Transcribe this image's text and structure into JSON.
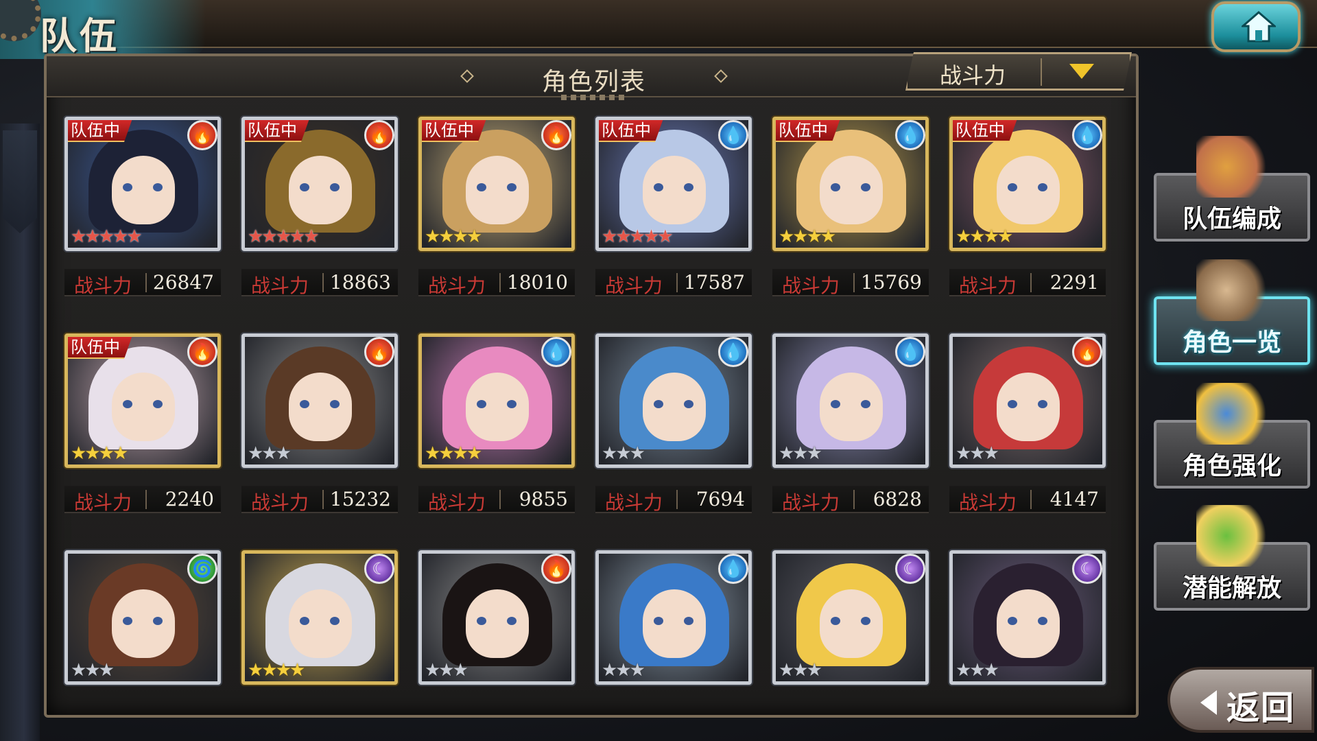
{
  "screen": {
    "title": "队伍"
  },
  "panel": {
    "title": "角色列表",
    "sort": {
      "selected": "战斗力"
    }
  },
  "colors": {
    "accent": "#6fe3f0",
    "in_team": "#d62a2a",
    "power_label": "#c93a35",
    "sort_arrow": "#f0c42a"
  },
  "power_label": "战斗力",
  "in_team_label": "队伍中",
  "characters": [
    {
      "in_team": true,
      "element": "fire",
      "stars": 5,
      "star_color": "red",
      "frame": "silver",
      "power": "26847",
      "hair": "#1d2236",
      "bg": "#3c5b9a"
    },
    {
      "in_team": true,
      "element": "fire",
      "stars": 5,
      "star_color": "red",
      "frame": "silver",
      "power": "18863",
      "hair": "#8a6a2c",
      "bg": "#3a3026"
    },
    {
      "in_team": true,
      "element": "fire",
      "stars": 4,
      "star_color": "gold",
      "frame": "gold",
      "power": "18010",
      "hair": "#caa060",
      "bg": "#c9b07a"
    },
    {
      "in_team": true,
      "element": "water",
      "stars": 5,
      "star_color": "red",
      "frame": "silver",
      "power": "17587",
      "hair": "#b8c8e6",
      "bg": "#6a7ab8"
    },
    {
      "in_team": true,
      "element": "water",
      "stars": 4,
      "star_color": "gold",
      "frame": "gold",
      "power": "15769",
      "hair": "#e9c07a",
      "bg": "#b89a4a"
    },
    {
      "in_team": true,
      "element": "water",
      "stars": 4,
      "star_color": "gold",
      "frame": "gold",
      "power": "2291",
      "hair": "#f1c86a",
      "bg": "#8a5a6a"
    },
    {
      "in_team": true,
      "element": "fire",
      "stars": 4,
      "star_color": "gold",
      "frame": "gold",
      "power": "2240",
      "hair": "#e8e0ea",
      "bg": "#c4a8b0"
    },
    {
      "in_team": false,
      "element": "fire",
      "stars": 3,
      "star_color": "silver",
      "frame": "silver",
      "power": "15232",
      "hair": "#5a3a26",
      "bg": "#8a8a8a"
    },
    {
      "in_team": false,
      "element": "water",
      "stars": 4,
      "star_color": "gold",
      "frame": "gold",
      "power": "9855",
      "hair": "#e88ac0",
      "bg": "#c07ab0"
    },
    {
      "in_team": false,
      "element": "water",
      "stars": 3,
      "star_color": "silver",
      "frame": "silver",
      "power": "7694",
      "hair": "#4a8acb",
      "bg": "#7a8a9a"
    },
    {
      "in_team": false,
      "element": "water",
      "stars": 3,
      "star_color": "silver",
      "frame": "silver",
      "power": "6828",
      "hair": "#c6b8e6",
      "bg": "#8a8ab0"
    },
    {
      "in_team": false,
      "element": "fire",
      "stars": 3,
      "star_color": "silver",
      "frame": "silver",
      "power": "4147",
      "hair": "#c63a3a",
      "bg": "#7a6a6a"
    },
    {
      "in_team": false,
      "element": "wind",
      "stars": 3,
      "star_color": "silver",
      "frame": "silver",
      "power": "",
      "hair": "#6a3a26",
      "bg": "#5a4a3a"
    },
    {
      "in_team": false,
      "element": "dark",
      "stars": 4,
      "star_color": "gold",
      "frame": "gold",
      "power": "",
      "hair": "#d8d8e0",
      "bg": "#c8a850"
    },
    {
      "in_team": false,
      "element": "fire",
      "stars": 3,
      "star_color": "silver",
      "frame": "silver",
      "power": "",
      "hair": "#1a1414",
      "bg": "#8a8a8a"
    },
    {
      "in_team": false,
      "element": "water",
      "stars": 3,
      "star_color": "silver",
      "frame": "silver",
      "power": "",
      "hair": "#3a7ac8",
      "bg": "#8a9aa8"
    },
    {
      "in_team": false,
      "element": "dark",
      "stars": 3,
      "star_color": "silver",
      "frame": "silver",
      "power": "",
      "hair": "#f0c84a",
      "bg": "#5a5a62"
    },
    {
      "in_team": false,
      "element": "dark",
      "stars": 3,
      "star_color": "silver",
      "frame": "silver",
      "power": "",
      "hair": "#2a2030",
      "bg": "#6a5a7a"
    }
  ],
  "side_menu": [
    {
      "label": "队伍编成",
      "icon": "team-formation-icon",
      "active": false
    },
    {
      "label": "角色一览",
      "icon": "character-book-icon",
      "active": true
    },
    {
      "label": "角色强化",
      "icon": "character-enhance-icon",
      "active": false
    },
    {
      "label": "潜能解放",
      "icon": "potential-release-icon",
      "active": false
    }
  ],
  "back_button": {
    "label": "返回"
  }
}
